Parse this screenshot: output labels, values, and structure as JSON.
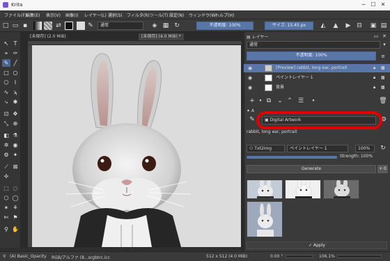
{
  "window": {
    "title": "Krita",
    "min_label": "─",
    "max_label": "☐",
    "close_label": "✕"
  },
  "menu": [
    "ファイル(F)",
    "編集(E)",
    "表示(V)",
    "画像(I)",
    "レイヤー(L)",
    "選択(S)",
    "フィルタ(R)",
    "ツール(T)",
    "設定(N)",
    "ウィンドウ(W)",
    "ヘルプ(H)"
  ],
  "toolbar": {
    "blend_mode": "通常",
    "opacity_label": "不透明度: 100%",
    "size_label": "サイズ: 15.45 px"
  },
  "tabs": [
    {
      "label": "[未保存]  (2.0 MiB)"
    },
    {
      "label": "[未保存]  (4.0 MiB) *"
    }
  ],
  "layers_panel": {
    "title": "レイヤー",
    "blend": "通常",
    "opacity": "不透明度: 100%",
    "layers": [
      {
        "name": "[Preview] rabbit, long ear, portrait",
        "selected": true
      },
      {
        "name": "ペイントレイヤー 1",
        "selected": false
      },
      {
        "name": "背景",
        "selected": false
      }
    ]
  },
  "ai_panel": {
    "title_prefix": "A",
    "style_select": "Digital Artwork",
    "prompt": "rabbit, long ear, portrait",
    "workspace_select": "Txt2Img",
    "layer_select": "ペイントレイヤー 1",
    "strength_value": "100%",
    "strength_label": "Strength: 100%",
    "generate_label": "Generate",
    "add_label": "+ 0",
    "apply_label": "✓ Apply"
  },
  "status": {
    "brush": "(A) Basic_Opacity",
    "color_model": "RGB/アルファ (8...srgbtrc.icc",
    "size": "512 x 512 (4.0 MiB)",
    "angle": "0.00 °",
    "zoom": "106.1%"
  },
  "colors": {
    "accent": "#5876a8",
    "highlight": "#e30000"
  }
}
